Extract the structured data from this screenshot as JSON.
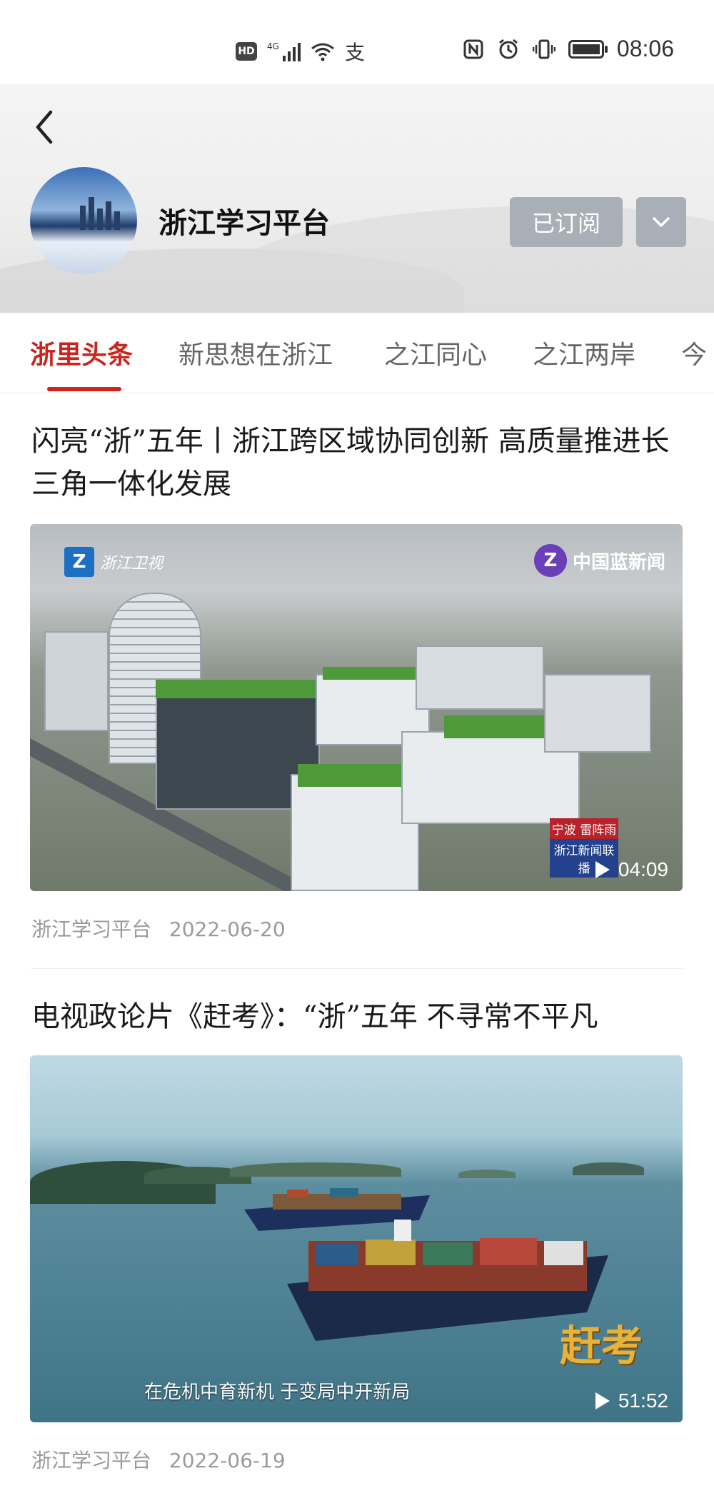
{
  "status_bar": {
    "network": "4G",
    "hd": "HD",
    "ime": "支",
    "time": "08:06"
  },
  "header": {
    "channel_name": "浙江学习平台",
    "subscribe_label": "已订阅",
    "icons": [
      "back-arrow",
      "chevron-down"
    ]
  },
  "tabs": [
    {
      "label": "浙里头条",
      "active": true
    },
    {
      "label": "新思想在浙江",
      "active": false
    },
    {
      "label": "之江同心",
      "active": false
    },
    {
      "label": "之江两岸",
      "active": false
    },
    {
      "label": "今",
      "active": false
    }
  ],
  "articles": [
    {
      "title": "闪亮“浙”五年丨浙江跨区域协同创新 高质量推进长三角一体化发展",
      "source": "浙江学习平台",
      "date": "2022-06-20",
      "duration": "04:09",
      "logo_left": "浙江卫视",
      "logo_right": "中国蓝新闻",
      "badge_top": "宁波 雷阵雨",
      "badge_bottom": "浙江新闻联播"
    },
    {
      "title": "电视政论片《赶考》：“浙”五年 不寻常不平凡",
      "source": "浙江学习平台",
      "date": "2022-06-19",
      "duration": "51:52",
      "caption": "在危机中育新机 于变局中开新局",
      "logo": "赶考"
    }
  ],
  "colors": {
    "accent": "#c8261e",
    "button_gray": "#a9afb6",
    "meta_gray": "#9a9a9a"
  }
}
